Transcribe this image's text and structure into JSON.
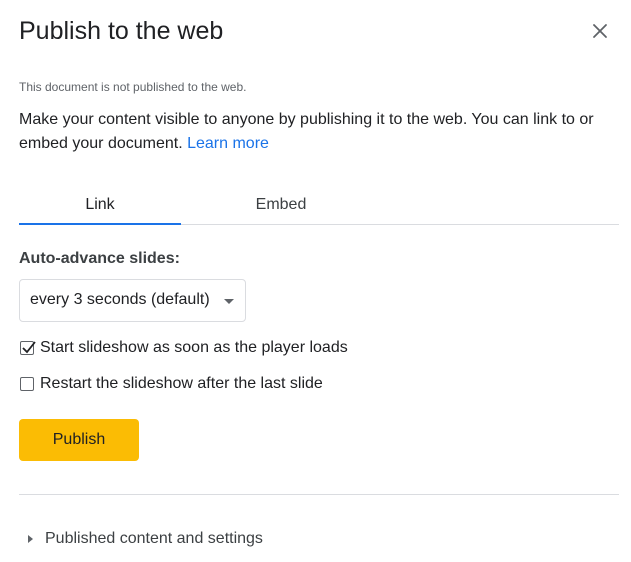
{
  "dialog": {
    "title": "Publish to the web",
    "close_icon": "close-icon"
  },
  "status": {
    "text": "This document is not published to the web."
  },
  "description": {
    "text": "Make your content visible to anyone by publishing it to the web. You can link to or embed your document.",
    "link_text": "Learn more"
  },
  "tabs": [
    {
      "label": "Link",
      "active": true
    },
    {
      "label": "Embed",
      "active": false
    }
  ],
  "settings": {
    "auto_advance_label": "Auto-advance slides:",
    "auto_advance_value": "every 3 seconds (default)",
    "checkboxes": [
      {
        "label": "Start slideshow as soon as the player loads",
        "checked": true
      },
      {
        "label": "Restart the slideshow after the last slide",
        "checked": false
      }
    ]
  },
  "actions": {
    "publish_label": "Publish"
  },
  "footer": {
    "expander_label": "Published content and settings",
    "expander_icon": "caret-right-icon"
  },
  "colors": {
    "accent": "#1a73e8",
    "publish_button": "#fbbc04",
    "divider": "#dadce0"
  }
}
